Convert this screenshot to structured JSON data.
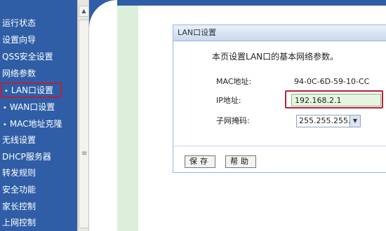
{
  "sidebar": {
    "items": [
      {
        "label": "运行状态"
      },
      {
        "label": "设置向导"
      },
      {
        "label": "QSS安全设置"
      },
      {
        "label": "网络参数"
      },
      {
        "label": "LAN口设置",
        "bullet": "•"
      },
      {
        "label": "WAN口设置",
        "bullet": "•"
      },
      {
        "label": "MAC地址克隆",
        "bullet": "•"
      },
      {
        "label": "无线设置"
      },
      {
        "label": "DHCP服务器"
      },
      {
        "label": "转发规则"
      },
      {
        "label": "安全功能"
      },
      {
        "label": "家长控制"
      },
      {
        "label": "上网控制"
      }
    ],
    "selected": "LAN口设置",
    "background": "#2f5ea6"
  },
  "panel": {
    "title": "LAN口设置",
    "description": "本页设置LAN口的基本网络参数。",
    "mac_label": "MAC地址:",
    "mac_value": "94-0C-6D-59-10-CC",
    "ip_label": "IP地址:",
    "ip_value": "192.168.2.1",
    "mask_label": "子网掩码:",
    "mask_value": "255.255.255.0",
    "save_label": "保存",
    "help_label": "帮助"
  },
  "colors": {
    "highlight_border": "#b4223c",
    "ip_field_bg": "#e6f5e0"
  },
  "icons": {
    "scroll_up": "scroll-up-arrow-icon",
    "select_arrow": "dropdown-arrow-icon"
  }
}
